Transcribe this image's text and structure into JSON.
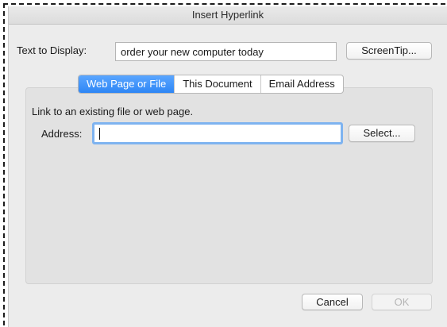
{
  "dialog": {
    "title": "Insert Hyperlink",
    "text_to_display_label": "Text to Display:",
    "text_to_display_value": "order your new computer today",
    "screentip_label": "ScreenTip...",
    "tabs": [
      {
        "label": "Web Page or File",
        "active": true
      },
      {
        "label": "This Document",
        "active": false
      },
      {
        "label": "Email Address",
        "active": false
      }
    ],
    "instruction": "Link to an existing file or web page.",
    "address_label": "Address:",
    "address_value": "",
    "select_label": "Select...",
    "cancel_label": "Cancel",
    "ok_label": "OK"
  },
  "colors": {
    "active_tab": "#2e86f5",
    "focus_ring": "#7eb3f0",
    "dialog_bg": "#ececec"
  }
}
